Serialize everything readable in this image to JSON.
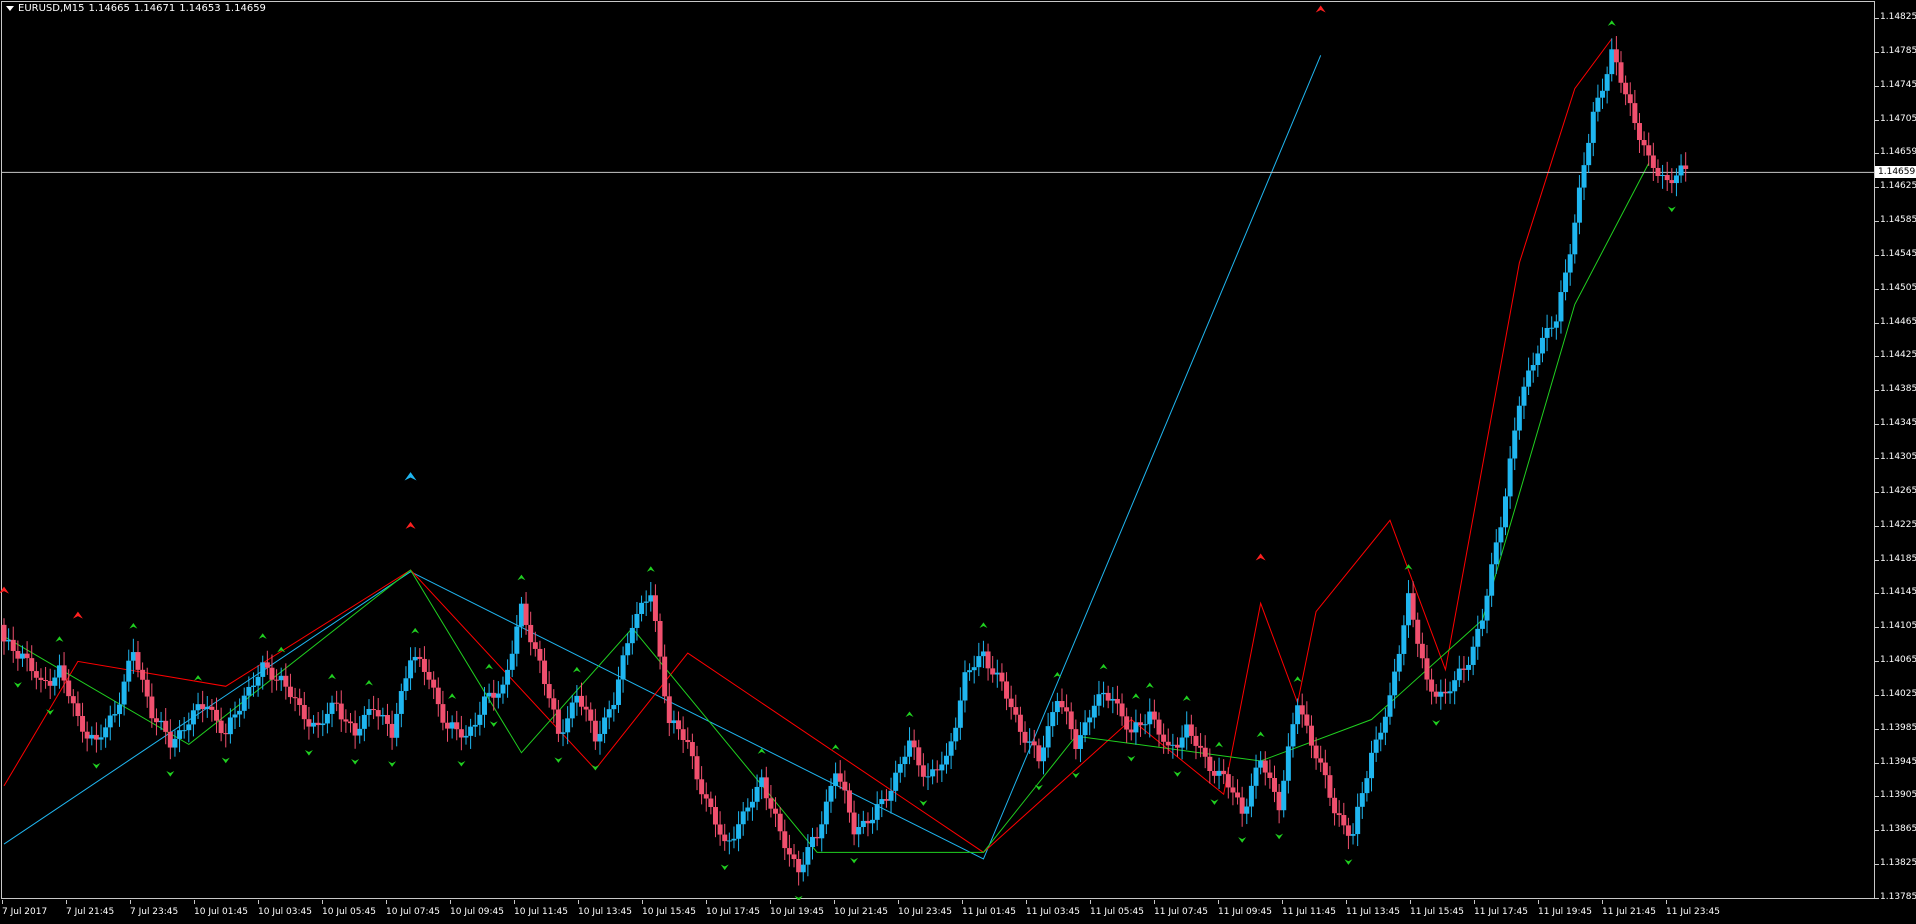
{
  "symbol": {
    "pair_timeframe": "EURUSD,M15",
    "open": "1.14665",
    "high": "1.14671",
    "low": "1.14653",
    "close": "1.14659"
  },
  "current_price_label": "1.14659",
  "colors": {
    "background": "#000000",
    "bull_candle": "#1fb6f0",
    "bear_candle": "#f0506e",
    "zigzag_major": "#1fb6f0",
    "zigzag_red": "#ff0000",
    "zigzag_green": "#20d020",
    "up_arrow": "#20d020",
    "down_arrow": "#ff2020",
    "price_line": "#c8c8c8"
  },
  "chart_data": {
    "type": "candlestick",
    "ylim": [
      1.13785,
      1.14845
    ],
    "y_ticks": [
      "1.14825",
      "1.14785",
      "1.14745",
      "1.14705",
      "1.14659",
      "1.14625",
      "1.14585",
      "1.14545",
      "1.14505",
      "1.14465",
      "1.14425",
      "1.14385",
      "1.14345",
      "1.14305",
      "1.14265",
      "1.14225",
      "1.14185",
      "1.14145",
      "1.14105",
      "1.14065",
      "1.14025",
      "1.13985",
      "1.13945",
      "1.13905",
      "1.13865",
      "1.13825",
      "1.13785"
    ],
    "x_ticks": [
      "7 Jul 2017",
      "7 Jul 21:45",
      "7 Jul 23:45",
      "10 Jul 01:45",
      "10 Jul 03:45",
      "10 Jul 05:45",
      "10 Jul 07:45",
      "10 Jul 09:45",
      "10 Jul 11:45",
      "10 Jul 13:45",
      "10 Jul 15:45",
      "10 Jul 17:45",
      "10 Jul 19:45",
      "10 Jul 21:45",
      "10 Jul 23:45",
      "11 Jul 01:45",
      "11 Jul 03:45",
      "11 Jul 05:45",
      "11 Jul 07:45",
      "11 Jul 09:45",
      "11 Jul 11:45",
      "11 Jul 13:45",
      "11 Jul 15:45",
      "11 Jul 17:45",
      "11 Jul 19:45",
      "11 Jul 21:45",
      "11 Jul 23:45"
    ],
    "current_price": 1.14659,
    "close_path": [
      [
        0,
        1.1409
      ],
      [
        4,
        1.1408
      ],
      [
        8,
        1.1404
      ],
      [
        12,
        1.1406
      ],
      [
        16,
        1.14
      ],
      [
        20,
        1.1397
      ],
      [
        24,
        1.1401
      ],
      [
        28,
        1.1408
      ],
      [
        32,
        1.1401
      ],
      [
        36,
        1.1397
      ],
      [
        40,
        1.14
      ],
      [
        44,
        1.1402
      ],
      [
        48,
        1.1398
      ],
      [
        52,
        1.1403
      ],
      [
        56,
        1.1406
      ],
      [
        60,
        1.1405
      ],
      [
        64,
        1.1401
      ],
      [
        68,
        1.1399
      ],
      [
        72,
        1.1402
      ],
      [
        76,
        1.1398
      ],
      [
        80,
        1.1402
      ],
      [
        84,
        1.1398
      ],
      [
        88,
        1.1408
      ],
      [
        92,
        1.1405
      ],
      [
        96,
        1.1399
      ],
      [
        100,
        1.1398
      ],
      [
        104,
        1.1402
      ],
      [
        108,
        1.1404
      ],
      [
        112,
        1.1413
      ],
      [
        116,
        1.1407
      ],
      [
        120,
        1.1398
      ],
      [
        124,
        1.1403
      ],
      [
        128,
        1.1398
      ],
      [
        132,
        1.1402
      ],
      [
        136,
        1.1412
      ],
      [
        140,
        1.1415
      ],
      [
        144,
        1.14
      ],
      [
        148,
        1.1397
      ],
      [
        152,
        1.139
      ],
      [
        156,
        1.1385
      ],
      [
        160,
        1.1388
      ],
      [
        164,
        1.1393
      ],
      [
        168,
        1.1386
      ],
      [
        172,
        1.1382
      ],
      [
        176,
        1.1386
      ],
      [
        180,
        1.1394
      ],
      [
        184,
        1.1387
      ],
      [
        188,
        1.1388
      ],
      [
        192,
        1.1392
      ],
      [
        196,
        1.1397
      ],
      [
        200,
        1.1393
      ],
      [
        204,
        1.1395
      ],
      [
        208,
        1.1405
      ],
      [
        212,
        1.1408
      ],
      [
        216,
        1.1404
      ],
      [
        220,
        1.1399
      ],
      [
        224,
        1.1395
      ],
      [
        228,
        1.1403
      ],
      [
        232,
        1.1397
      ],
      [
        236,
        1.1402
      ],
      [
        240,
        1.1403
      ],
      [
        244,
        1.1398
      ],
      [
        248,
        1.1401
      ],
      [
        252,
        1.1396
      ],
      [
        256,
        1.1399
      ],
      [
        260,
        1.1395
      ],
      [
        264,
        1.1393
      ],
      [
        268,
        1.1389
      ],
      [
        272,
        1.1395
      ],
      [
        276,
        1.139
      ],
      [
        280,
        1.1402
      ],
      [
        284,
        1.1396
      ],
      [
        288,
        1.1389
      ],
      [
        292,
        1.1386
      ],
      [
        296,
        1.1396
      ],
      [
        300,
        1.1402
      ],
      [
        304,
        1.1415
      ],
      [
        308,
        1.1404
      ],
      [
        312,
        1.1403
      ],
      [
        316,
        1.1406
      ],
      [
        320,
        1.1412
      ],
      [
        324,
        1.1424
      ],
      [
        328,
        1.1438
      ],
      [
        332,
        1.1445
      ],
      [
        336,
        1.1448
      ],
      [
        340,
        1.146
      ],
      [
        344,
        1.1473
      ],
      [
        348,
        1.148
      ],
      [
        352,
        1.1474
      ],
      [
        356,
        1.1467
      ],
      [
        360,
        1.1465
      ],
      [
        364,
        1.1466
      ]
    ]
  }
}
